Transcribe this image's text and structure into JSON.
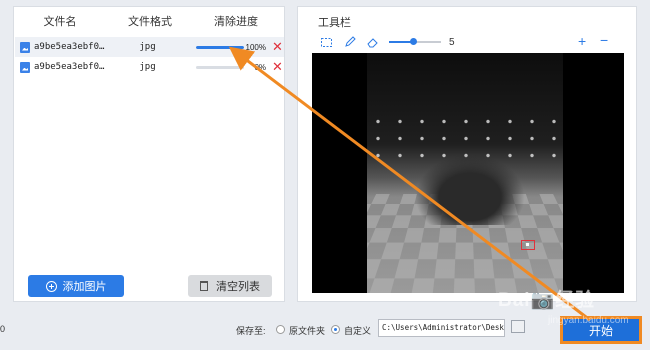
{
  "table": {
    "headers": [
      "文件名",
      "文件格式",
      "清除进度"
    ],
    "rows": [
      {
        "name": "a9be5ea3ebf0…",
        "format": "jpg",
        "progress_text": "100%",
        "progress": 1.0
      },
      {
        "name": "a9be5ea3ebf0…",
        "format": "jpg",
        "progress_text": "0%",
        "progress": 0.0
      }
    ]
  },
  "left_buttons": {
    "add": "添加图片",
    "clear": "清空列表"
  },
  "toolbar": {
    "title": "工具栏",
    "brush_size": "5",
    "zoom_in": "+",
    "zoom_out": "−"
  },
  "bottom": {
    "edge_text": "0",
    "save_to": "保存至:",
    "opt_original": "原文件夹",
    "opt_custom": "自定义",
    "path": "C:\\Users\\Administrator\\Desktop",
    "start": "开始"
  },
  "watermark": {
    "main": "Bai📷经验",
    "sub": "jingyan.baidu.com"
  },
  "colors": {
    "accent": "#2c7be5",
    "delete": "#e0313c",
    "annotation": "#f08a23"
  }
}
